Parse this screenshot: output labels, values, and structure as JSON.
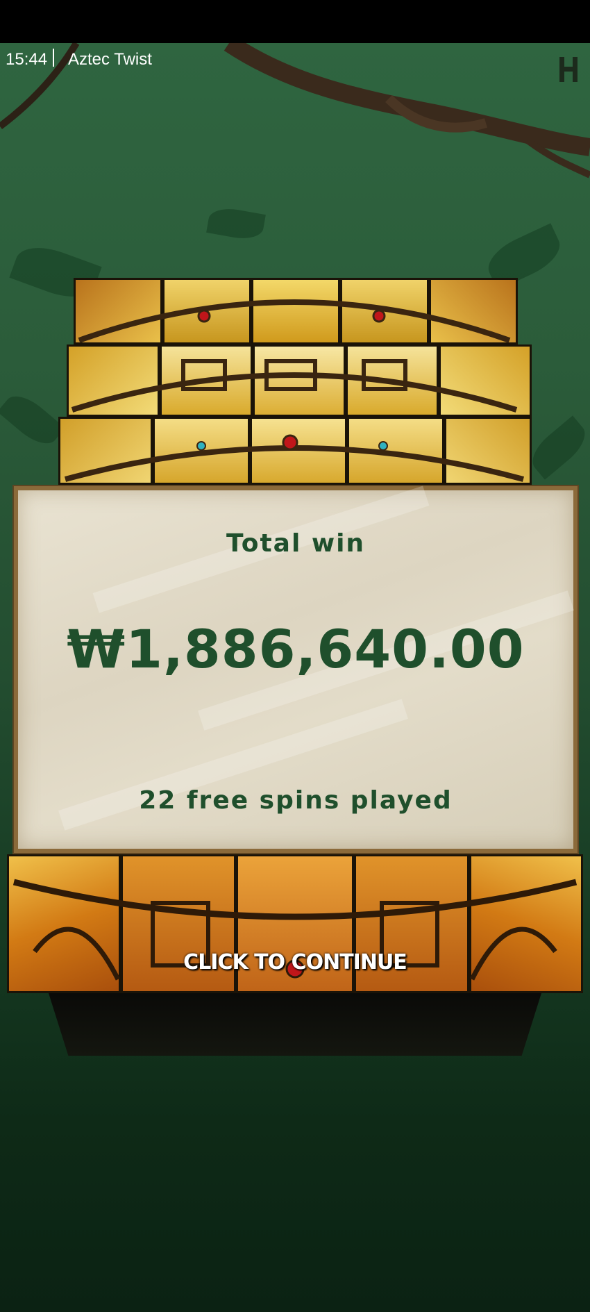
{
  "status_bar": {
    "time": "15:44",
    "title": "Aztec Twist"
  },
  "icons": {
    "menu": "h-logo-icon"
  },
  "dialog": {
    "label": "Total win",
    "amount": "₩1,886,640.00",
    "spins": "22 free spins played"
  },
  "continue_label": "CLICK TO CONTINUE",
  "colors": {
    "panel_text": "#1f4f2c",
    "panel_bg": "#e3dcc9",
    "panel_frame": "#8b6a3a",
    "jungle": "#2b5c3a"
  }
}
